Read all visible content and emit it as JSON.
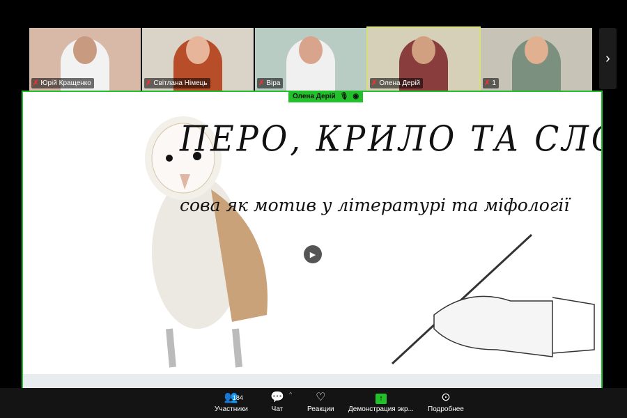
{
  "participants": [
    {
      "name": "Юрій Кращенко",
      "bg": "#d8b9a8",
      "skin": "#c89a80",
      "cloth": "#f2f2f2"
    },
    {
      "name": "Світлана Німець",
      "bg": "#d9d3c8",
      "skin": "#e7b59a",
      "cloth": "#b84d2a"
    },
    {
      "name": "Віра",
      "bg": "#b9ccc4",
      "skin": "#d9a48c",
      "cloth": "#f0f0f0"
    },
    {
      "name": "Олена Дерій",
      "bg": "#d6d0b8",
      "skin": "#d0a080",
      "cloth": "#8a3d3d"
    },
    {
      "name": "1",
      "bg": "#c7c4b7",
      "skin": "#e0b090",
      "cloth": "#7c9080"
    }
  ],
  "active_speaker": "Олена Дерій",
  "slide": {
    "title": "ПЕРО, КРИЛО ТА СЛОВО",
    "subtitle": "сова як мотив у літературі та міфології"
  },
  "toolbar": {
    "participants": {
      "label": "Участники",
      "count": "184"
    },
    "chat": {
      "label": "Чат"
    },
    "reactions": {
      "label": "Реакции"
    },
    "share": {
      "label": "Демонстрация экр..."
    },
    "more": {
      "label": "Подробнее"
    }
  },
  "colors": {
    "accent": "#22c02a"
  }
}
